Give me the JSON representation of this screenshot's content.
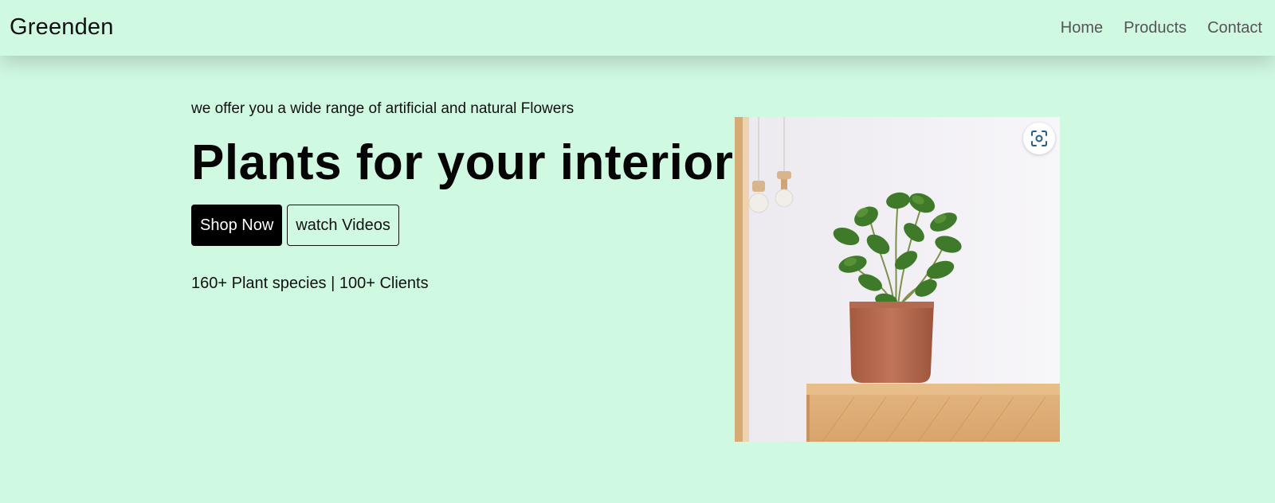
{
  "navbar": {
    "brand": "Greenden",
    "links": [
      {
        "label": "Home"
      },
      {
        "label": "Products"
      },
      {
        "label": "Contact"
      }
    ]
  },
  "hero": {
    "tagline": "we offer you a wide range of artificial and natural Flowers",
    "headline": "Plants for your interior",
    "primary_button": "Shop Now",
    "secondary_button": "watch Videos",
    "stats": "160+ Plant species | 100+ Clients"
  },
  "image": {
    "subject": "potted plant on wooden cabinet",
    "overlay_icon": "visual-search-icon"
  },
  "colors": {
    "background": "#d0f9e2",
    "primary_button_bg": "#000000",
    "text": "#111111"
  }
}
